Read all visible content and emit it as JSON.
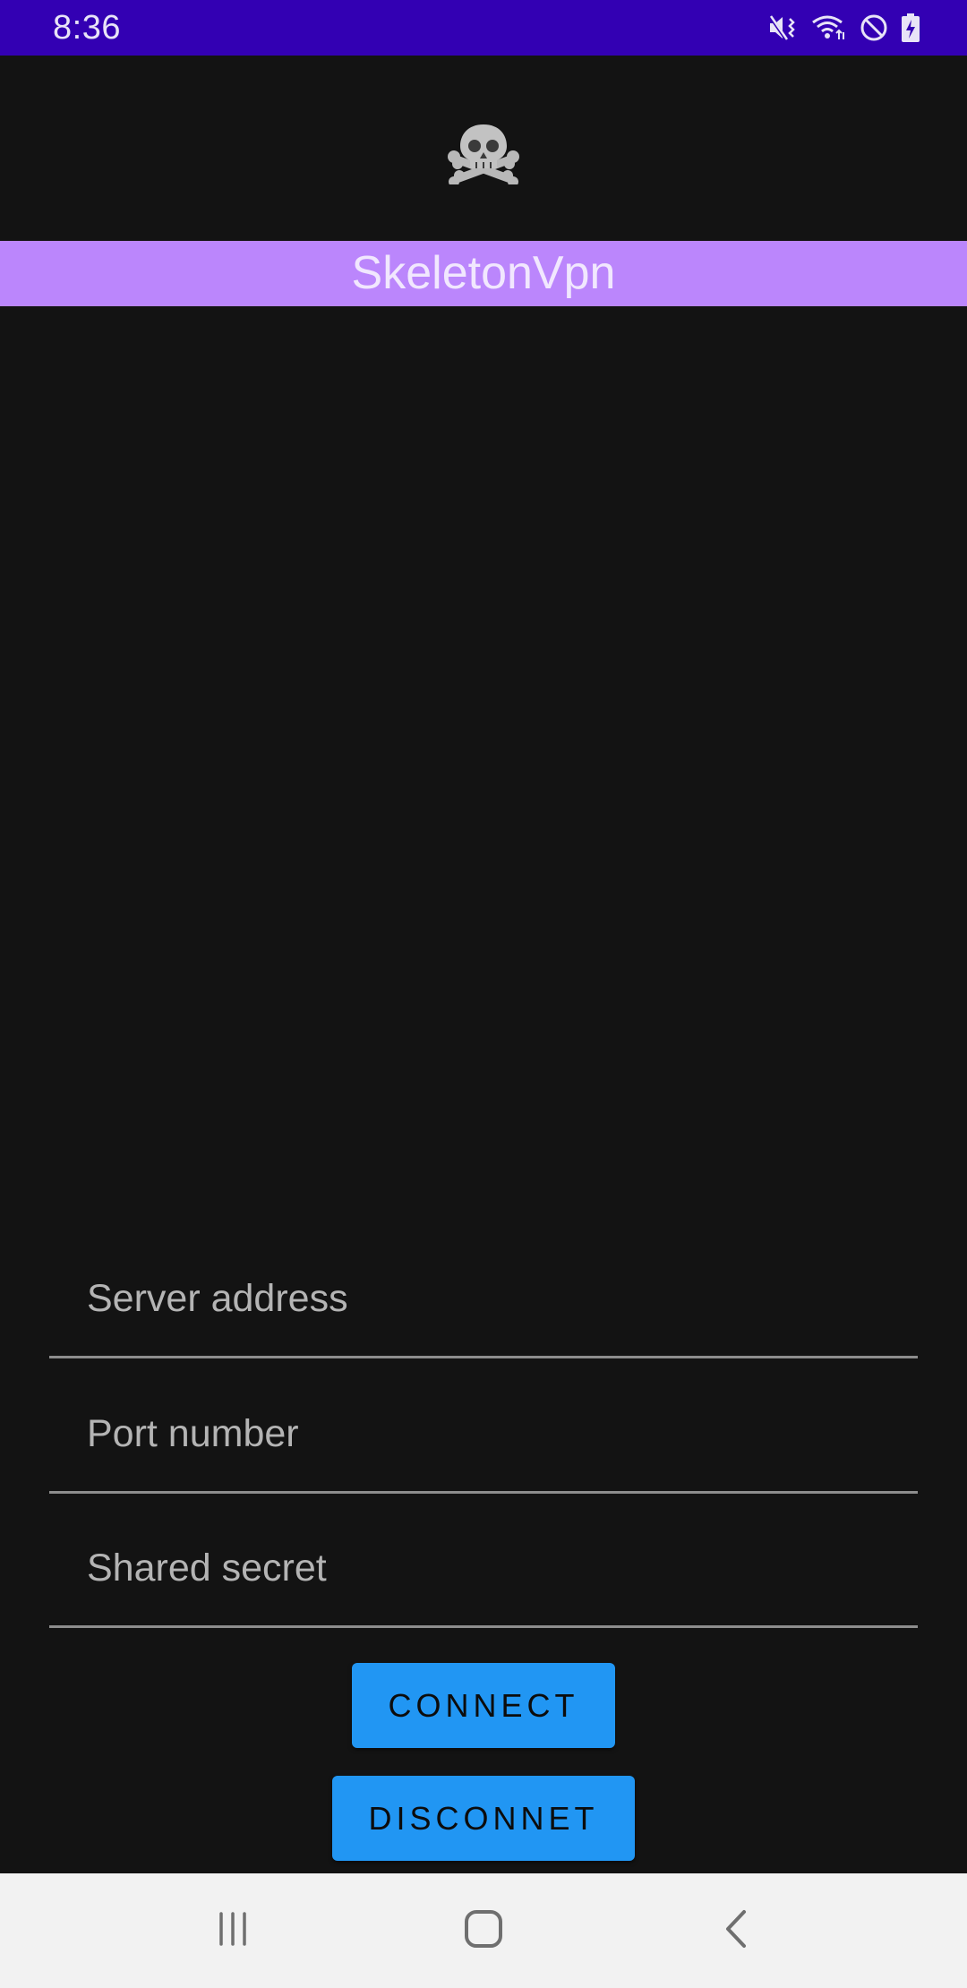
{
  "status_bar": {
    "time": "8:36",
    "icons": [
      "mute-vibrate-icon",
      "wifi-icon",
      "do-not-disturb-icon",
      "battery-charging-icon"
    ]
  },
  "app": {
    "logo_icon": "skull-crossbones-icon",
    "title": "SkeletonVpn",
    "title_bar_color": "#bb86fc"
  },
  "form": {
    "server_address": {
      "value": "",
      "placeholder": "Server address"
    },
    "port_number": {
      "value": "",
      "placeholder": "Port number"
    },
    "shared_secret": {
      "value": "",
      "placeholder": "Shared secret"
    }
  },
  "buttons": {
    "connect_label": "CONNECT",
    "disconnect_label": "DISCONNET",
    "color": "#2196f3"
  },
  "nav_bar": {
    "icons": [
      "recent-apps-icon",
      "home-icon",
      "back-icon"
    ]
  }
}
